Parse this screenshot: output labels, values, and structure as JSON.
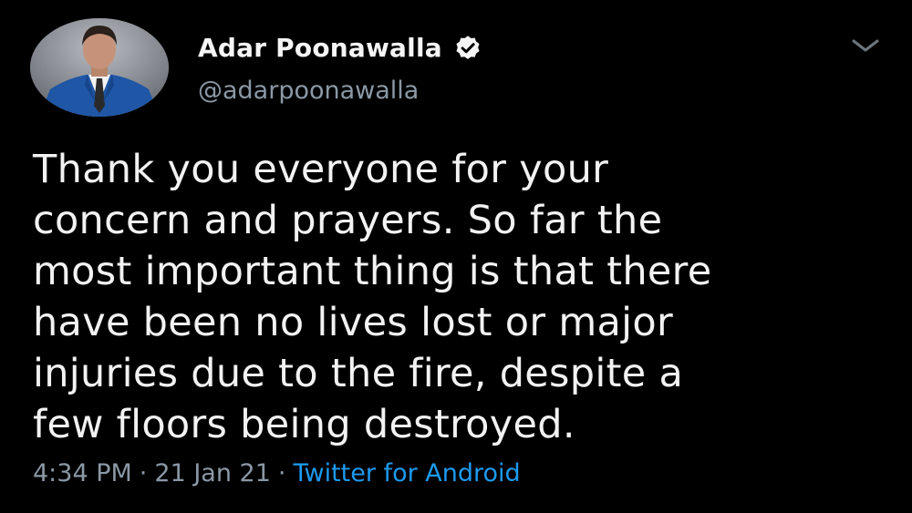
{
  "author": {
    "display_name": "Adar Poonawalla",
    "handle": "@adarpoonawalla",
    "verified_icon": "verified-badge-icon",
    "avatar_icon": "profile-photo"
  },
  "menu": {
    "icon": "chevron-down-icon"
  },
  "tweet": {
    "text": "Thank you everyone for your\nconcern and prayers. So far the\nmost important thing is that there\nhave been no lives lost or major\ninjuries due to the fire, despite a\nfew floors being destroyed."
  },
  "meta": {
    "time": "4:34 PM",
    "date": "21 Jan 21",
    "separator": "·",
    "source": "Twitter for Android"
  },
  "colors": {
    "background": "#000000",
    "text": "#f2f2f2",
    "secondary": "#8b98a5",
    "link": "#1d9bf0"
  }
}
